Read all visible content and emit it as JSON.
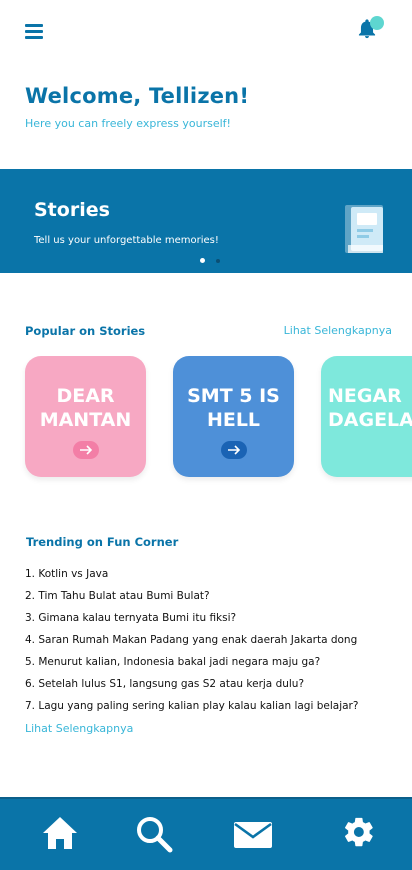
{
  "header": {
    "menu_icon": "hamburger-menu-icon",
    "notification_icon": "bell-icon",
    "colors": {
      "primary": "#0a74a8",
      "accent": "#39b6d8",
      "badge": "#5ed6d0"
    }
  },
  "welcome": {
    "title": "Welcome, Tellizen!",
    "subtitle": "Here you can freely express yourself!"
  },
  "banner": {
    "title": "Stories",
    "subtitle": "Tell us your unforgettable memories!",
    "icon": "book-icon",
    "slides": 2,
    "active_slide": 1
  },
  "popular": {
    "title": "Popular on Stories",
    "see_more": "Lihat Selengkapnya",
    "cards": [
      {
        "line1": "DEAR",
        "line2": "MANTAN",
        "color": "#f7a8c3"
      },
      {
        "line1": "SMT 5 IS",
        "line2": "HELL",
        "color": "#4e90d8"
      },
      {
        "line1": "NEGAR",
        "line2": "DAGELA",
        "color": "#7ee8dc"
      }
    ]
  },
  "trending": {
    "title": "Trending on Fun Corner",
    "items": [
      "1. Kotlin vs Java",
      "2. Tim Tahu Bulat atau Bumi Bulat?",
      "3. Gimana kalau ternyata Bumi itu fiksi?",
      "4. Saran Rumah Makan Padang yang enak daerah Jakarta dong",
      "5. Menurut kalian, Indonesia bakal jadi negara maju ga?",
      "6. Setelah lulus S1, langsung gas S2 atau kerja dulu?",
      "7. Lagu yang paling sering kalian play kalau kalian lagi belajar?"
    ],
    "see_more": "Lihat Selengkapnya"
  },
  "bottom_nav": {
    "items": [
      "home-icon",
      "search-icon",
      "mail-icon",
      "settings-gear-icon"
    ]
  }
}
